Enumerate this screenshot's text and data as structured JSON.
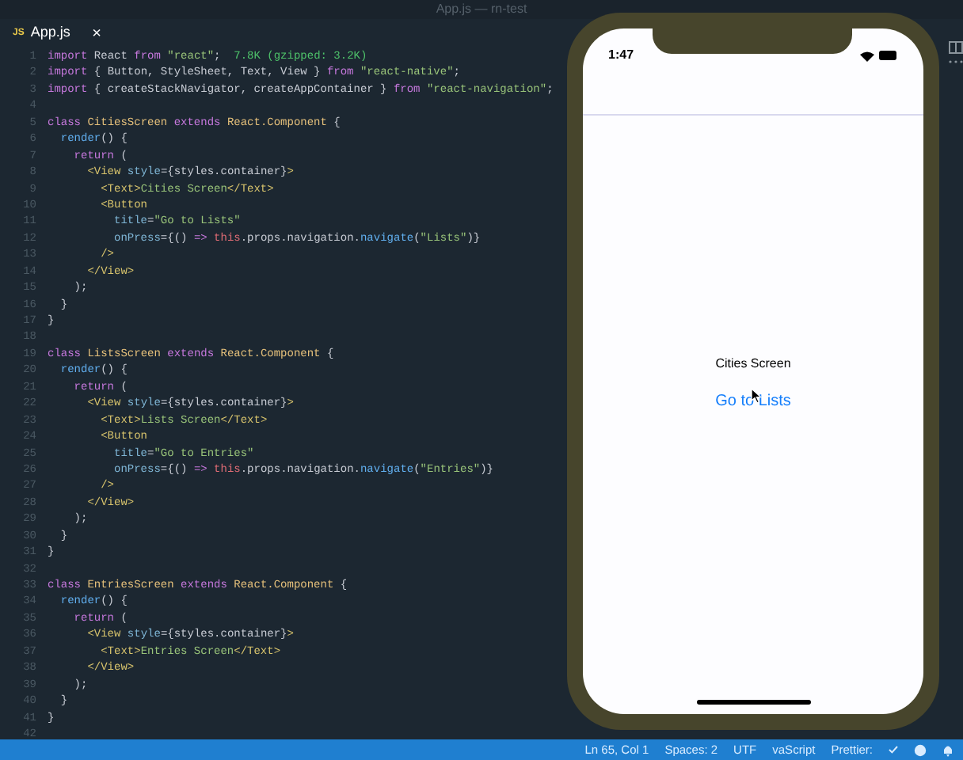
{
  "window": {
    "title": "App.js — rn-test"
  },
  "tabs": [
    {
      "icon": "JS",
      "label": "App.js",
      "selected": true,
      "close": "×"
    }
  ],
  "code": [
    {
      "number": "1",
      "tokens": [
        {
          "kind": "keyword",
          "t": "import"
        },
        {
          "kind": "plain",
          "t": " React "
        },
        {
          "kind": "keyword",
          "t": "from"
        },
        {
          "kind": "string",
          "t": " \"react\""
        },
        {
          "kind": "plain",
          "t": ";  "
        },
        {
          "kind": "hint",
          "t": "7.8K (gzipped: 3.2K)"
        }
      ]
    },
    {
      "number": "2",
      "tokens": [
        {
          "kind": "keyword",
          "t": "import"
        },
        {
          "kind": "plain",
          "t": " { Button, StyleSheet, Text, View } "
        },
        {
          "kind": "keyword",
          "t": "from"
        },
        {
          "kind": "string",
          "t": " \"react-native\""
        },
        {
          "kind": "plain",
          "t": ";"
        }
      ]
    },
    {
      "number": "3",
      "tokens": [
        {
          "kind": "keyword",
          "t": "import"
        },
        {
          "kind": "plain",
          "t": " { createStackNavigator, createAppContainer } "
        },
        {
          "kind": "keyword",
          "t": "from"
        },
        {
          "kind": "string",
          "t": " \"react-navigation\""
        },
        {
          "kind": "plain",
          "t": ";"
        }
      ]
    },
    {
      "number": "4"
    },
    {
      "number": "5",
      "tokens": [
        {
          "kind": "keyword",
          "t": "class "
        },
        {
          "kind": "class",
          "t": "CitiesScreen "
        },
        {
          "kind": "keyword",
          "t": "extends "
        },
        {
          "kind": "class",
          "t": "React.Component"
        },
        {
          "kind": "plain",
          "t": " {"
        }
      ]
    },
    {
      "number": "6",
      "tokens": [
        {
          "kind": "function",
          "t": "  render"
        },
        {
          "kind": "plain",
          "t": "() {"
        }
      ]
    },
    {
      "number": "7",
      "tokens": [
        {
          "kind": "keyword",
          "t": "    return"
        },
        {
          "kind": "plain",
          "t": " ("
        }
      ]
    },
    {
      "number": "8",
      "tokens": [
        {
          "kind": "tag",
          "t": "      <View "
        },
        {
          "kind": "attr",
          "t": "style"
        },
        {
          "kind": "plain",
          "t": "={styles.container}"
        },
        {
          "kind": "tag",
          "t": ">"
        }
      ]
    },
    {
      "number": "9",
      "tokens": [
        {
          "kind": "tag",
          "t": "        <Text>"
        },
        {
          "kind": "string",
          "t": "Cities Screen"
        },
        {
          "kind": "tag",
          "t": "</Text>"
        }
      ]
    },
    {
      "number": "10",
      "tokens": [
        {
          "kind": "tag",
          "t": "        <Button"
        }
      ]
    },
    {
      "number": "11",
      "tokens": [
        {
          "kind": "attr",
          "t": "          title"
        },
        {
          "kind": "plain",
          "t": "="
        },
        {
          "kind": "string",
          "t": "\"Go to Lists\""
        }
      ]
    },
    {
      "number": "12",
      "tokens": [
        {
          "kind": "attr",
          "t": "          onPress"
        },
        {
          "kind": "plain",
          "t": "={() "
        },
        {
          "kind": "keyword",
          "t": "=> "
        },
        {
          "kind": "this",
          "t": "this"
        },
        {
          "kind": "plain",
          "t": ".props.navigation."
        },
        {
          "kind": "function",
          "t": "navigate"
        },
        {
          "kind": "plain",
          "t": "("
        },
        {
          "kind": "string",
          "t": "\"Lists\""
        },
        {
          "kind": "plain",
          "t": ")}"
        }
      ]
    },
    {
      "number": "13",
      "tokens": [
        {
          "kind": "tag",
          "t": "        />"
        }
      ]
    },
    {
      "number": "14",
      "tokens": [
        {
          "kind": "tag",
          "t": "      </View>"
        }
      ]
    },
    {
      "number": "15",
      "tokens": [
        {
          "kind": "plain",
          "t": "    );"
        }
      ]
    },
    {
      "number": "16",
      "tokens": [
        {
          "kind": "plain",
          "t": "  }"
        }
      ]
    },
    {
      "number": "17",
      "tokens": [
        {
          "kind": "plain",
          "t": "}"
        }
      ]
    },
    {
      "number": "18"
    },
    {
      "number": "19",
      "tokens": [
        {
          "kind": "keyword",
          "t": "class "
        },
        {
          "kind": "class",
          "t": "ListsScreen "
        },
        {
          "kind": "keyword",
          "t": "extends "
        },
        {
          "kind": "class",
          "t": "React.Component"
        },
        {
          "kind": "plain",
          "t": " {"
        }
      ]
    },
    {
      "number": "20",
      "tokens": [
        {
          "kind": "function",
          "t": "  render"
        },
        {
          "kind": "plain",
          "t": "() {"
        }
      ]
    },
    {
      "number": "21",
      "tokens": [
        {
          "kind": "keyword",
          "t": "    return"
        },
        {
          "kind": "plain",
          "t": " ("
        }
      ]
    },
    {
      "number": "22",
      "tokens": [
        {
          "kind": "tag",
          "t": "      <View "
        },
        {
          "kind": "attr",
          "t": "style"
        },
        {
          "kind": "plain",
          "t": "={styles.container}"
        },
        {
          "kind": "tag",
          "t": ">"
        }
      ]
    },
    {
      "number": "23",
      "tokens": [
        {
          "kind": "tag",
          "t": "        <Text>"
        },
        {
          "kind": "string",
          "t": "Lists Screen"
        },
        {
          "kind": "tag",
          "t": "</Text>"
        }
      ]
    },
    {
      "number": "24",
      "tokens": [
        {
          "kind": "tag",
          "t": "        <Button"
        }
      ]
    },
    {
      "number": "25",
      "tokens": [
        {
          "kind": "attr",
          "t": "          title"
        },
        {
          "kind": "plain",
          "t": "="
        },
        {
          "kind": "string",
          "t": "\"Go to Entries\""
        }
      ]
    },
    {
      "number": "26",
      "tokens": [
        {
          "kind": "attr",
          "t": "          onPress"
        },
        {
          "kind": "plain",
          "t": "={() "
        },
        {
          "kind": "keyword",
          "t": "=> "
        },
        {
          "kind": "this",
          "t": "this"
        },
        {
          "kind": "plain",
          "t": ".props.navigation."
        },
        {
          "kind": "function",
          "t": "navigate"
        },
        {
          "kind": "plain",
          "t": "("
        },
        {
          "kind": "string",
          "t": "\"Entries\""
        },
        {
          "kind": "plain",
          "t": ")}"
        }
      ]
    },
    {
      "number": "27",
      "tokens": [
        {
          "kind": "tag",
          "t": "        />"
        }
      ]
    },
    {
      "number": "28",
      "tokens": [
        {
          "kind": "tag",
          "t": "      </View>"
        }
      ]
    },
    {
      "number": "29",
      "tokens": [
        {
          "kind": "plain",
          "t": "    );"
        }
      ]
    },
    {
      "number": "30",
      "tokens": [
        {
          "kind": "plain",
          "t": "  }"
        }
      ]
    },
    {
      "number": "31",
      "tokens": [
        {
          "kind": "plain",
          "t": "}"
        }
      ]
    },
    {
      "number": "32"
    },
    {
      "number": "33",
      "tokens": [
        {
          "kind": "keyword",
          "t": "class "
        },
        {
          "kind": "class",
          "t": "EntriesScreen "
        },
        {
          "kind": "keyword",
          "t": "extends "
        },
        {
          "kind": "class",
          "t": "React.Component"
        },
        {
          "kind": "plain",
          "t": " {"
        }
      ]
    },
    {
      "number": "34",
      "tokens": [
        {
          "kind": "function",
          "t": "  render"
        },
        {
          "kind": "plain",
          "t": "() {"
        }
      ]
    },
    {
      "number": "35",
      "tokens": [
        {
          "kind": "keyword",
          "t": "    return"
        },
        {
          "kind": "plain",
          "t": " ("
        }
      ]
    },
    {
      "number": "36",
      "tokens": [
        {
          "kind": "tag",
          "t": "      <View "
        },
        {
          "kind": "attr",
          "t": "style"
        },
        {
          "kind": "plain",
          "t": "={styles.container}"
        },
        {
          "kind": "tag",
          "t": ">"
        }
      ]
    },
    {
      "number": "37",
      "tokens": [
        {
          "kind": "tag",
          "t": "        <Text>"
        },
        {
          "kind": "string",
          "t": "Entries Screen"
        },
        {
          "kind": "tag",
          "t": "</Text>"
        }
      ]
    },
    {
      "number": "38",
      "tokens": [
        {
          "kind": "tag",
          "t": "      </View>"
        }
      ]
    },
    {
      "number": "39",
      "tokens": [
        {
          "kind": "plain",
          "t": "    );"
        }
      ]
    },
    {
      "number": "40",
      "tokens": [
        {
          "kind": "plain",
          "t": "  }"
        }
      ]
    },
    {
      "number": "41",
      "tokens": [
        {
          "kind": "plain",
          "t": "}"
        }
      ]
    },
    {
      "number": "42"
    }
  ],
  "phone": {
    "time": "1:47",
    "screen_text": "Cities Screen",
    "button": "Go to Lists"
  },
  "status_bar": {
    "items": [
      "Ln 65, Col 1",
      "Spaces: 2",
      "UTF",
      "vaScript",
      "Prettier:"
    ]
  }
}
